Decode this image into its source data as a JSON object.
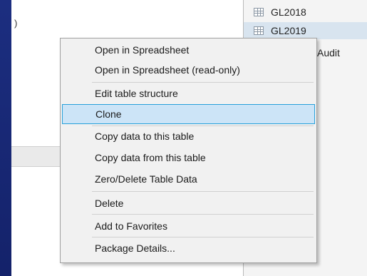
{
  "left_pane": {
    "label": ")"
  },
  "tree": {
    "items": [
      {
        "label": "GL2018"
      },
      {
        "label": "GL2019"
      }
    ],
    "audit_label": "Audit"
  },
  "context_menu": {
    "items": [
      {
        "label": "Open in Spreadsheet"
      },
      {
        "label": "Open in Spreadsheet (read-only)"
      },
      {
        "label": "Edit table structure"
      },
      {
        "label": "Clone"
      },
      {
        "label": "Copy data to this table"
      },
      {
        "label": "Copy data from this table"
      },
      {
        "label": "Zero/Delete Table Data"
      },
      {
        "label": "Delete"
      },
      {
        "label": "Add to Favorites"
      },
      {
        "label": "Package Details..."
      }
    ],
    "highlighted": "Clone"
  },
  "colors": {
    "desktop": "#1a2a78",
    "highlight_bg": "#cce4f7",
    "highlight_border": "#26a0da",
    "selected_tree_bg": "#d8e4ef"
  }
}
